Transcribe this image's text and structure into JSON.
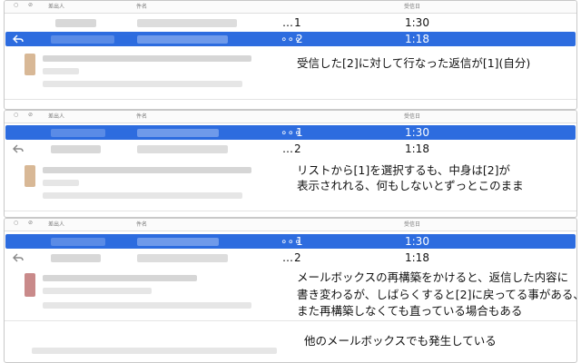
{
  "columns": {
    "sender": "差出人",
    "subject": "件名",
    "received": "受信日"
  },
  "colors": {
    "selection": "#2d6cdf",
    "text": "#111111"
  },
  "panels": [
    {
      "rows": [
        {
          "num": "1",
          "time": "1:30",
          "selected": false,
          "replied": false
        },
        {
          "num": "2",
          "time": "1:18",
          "selected": true,
          "replied": true
        }
      ],
      "note_lines": [
        "受信した[2]に対して行なった返信が[1](自分)"
      ]
    },
    {
      "rows": [
        {
          "num": "1",
          "time": "1:30",
          "selected": true,
          "replied": false
        },
        {
          "num": "2",
          "time": "1:18",
          "selected": false,
          "replied": true
        }
      ],
      "note_lines": [
        "リストから[1]を選択するも、中身は[2]が",
        "表示されれる、何もしないとずっとこのまま"
      ]
    },
    {
      "rows": [
        {
          "num": "1",
          "time": "1:30",
          "selected": true,
          "replied": false
        },
        {
          "num": "2",
          "time": "1:18",
          "selected": false,
          "replied": true
        }
      ],
      "note_lines": [
        "メールボックスの再構築をかけると、返信した内容に",
        "書き変わるが、しばらくすると[2]に戻ってる事がある、",
        "また再構築しなくても直っている場合もある"
      ],
      "note_extra": "他のメールボックスでも発生している"
    }
  ]
}
